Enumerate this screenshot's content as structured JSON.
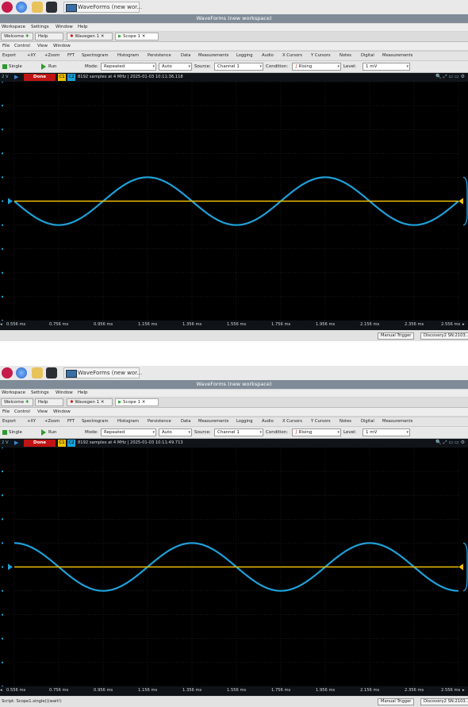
{
  "taskbar": {
    "task_title": "WaveForms (new wor..."
  },
  "window_title": "WaveForms (new workspace)",
  "menus": [
    "Workspace",
    "Settings",
    "Window",
    "Help"
  ],
  "tabs": {
    "welcome": "Welcome",
    "help": "Help",
    "wavegen": "Wavegen 1",
    "scope": "Scope 1"
  },
  "submenu": [
    "File",
    "Control",
    "View",
    "Window"
  ],
  "toolbar": [
    "Export",
    "+XY",
    "+Zoom",
    "FFT",
    "Spectrogram",
    "Histogram",
    "Persistence",
    "Data",
    "Measurements",
    "Logging",
    "Audio",
    "X Cursors",
    "Y Cursors",
    "Notes",
    "Digital",
    "Measurements"
  ],
  "controls": {
    "single": "Single",
    "run": "Run",
    "mode_label": "Mode:",
    "mode_value": "Repeated",
    "auto_value": "Auto",
    "source_label": "Source:",
    "source_value": "Channel 1",
    "condition_label": "Condition:",
    "condition_value": "Rising",
    "level_label": "Level:",
    "level_value": "1 mV"
  },
  "info": {
    "done": "Done",
    "c1": "C1",
    "c2": "C2",
    "volts": "2 V"
  },
  "x_ticks": [
    "0.556 ms",
    "0.756 ms",
    "0.956 ms",
    "1.156 ms",
    "1.356 ms",
    "1.556 ms",
    "1.756 ms",
    "1.956 ms",
    "2.156 ms",
    "2.356 ms",
    "2.556 ms"
  ],
  "status": {
    "manual_trigger": "Manual Trigger",
    "device": "Discovery2 SN:2103..."
  },
  "screenshots": [
    {
      "info_text": "8192 samples at 4 MHz | 2025-01-03 10:11:36.118",
      "status_script": "",
      "chart_data": {
        "type": "line",
        "x_range": [
          0.556,
          2.556
        ],
        "x_unit": "ms",
        "ylim": [
          -5,
          5
        ],
        "series": [
          {
            "color": "#1fa0d8",
            "kind": "sine",
            "amplitude": 1.0,
            "period": 0.8,
            "phase_deg": 180,
            "offset": 0
          },
          {
            "color": "#f0c000",
            "kind": "flat",
            "offset": 0
          }
        ]
      }
    },
    {
      "info_text": "8192 samples at 4 MHz | 2025-01-03 10:11:49.713",
      "status_script": "Script: Scope1.single()(wait!)",
      "chart_data": {
        "type": "line",
        "x_range": [
          0.556,
          2.556
        ],
        "x_unit": "ms",
        "ylim": [
          -5,
          5
        ],
        "series": [
          {
            "color": "#1fa0d8",
            "kind": "sine",
            "amplitude": 1.0,
            "period": 0.8,
            "phase_deg": 90,
            "offset": 0
          },
          {
            "color": "#f0c000",
            "kind": "flat",
            "offset": 0
          }
        ]
      }
    }
  ]
}
